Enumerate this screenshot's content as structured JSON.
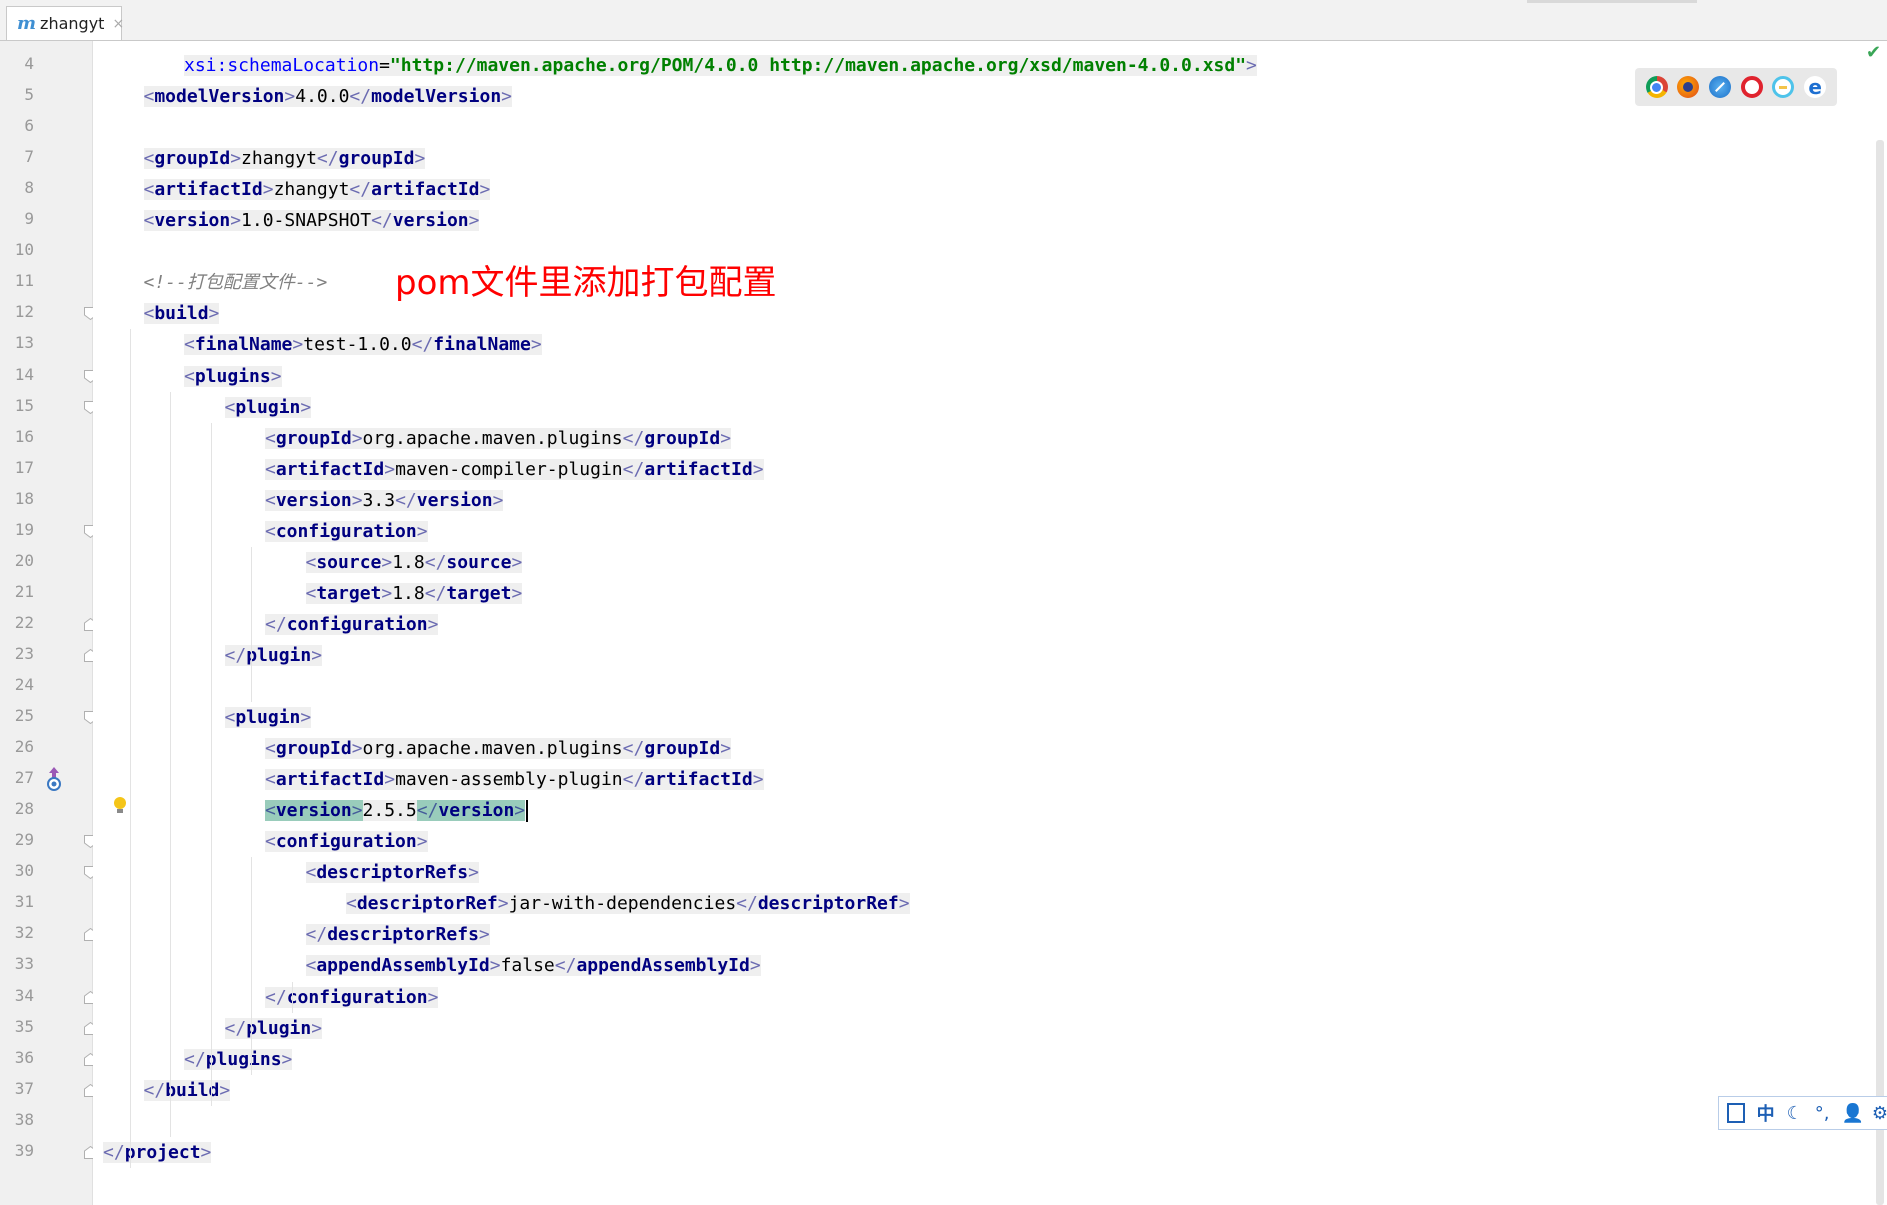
{
  "tab": {
    "icon": "m",
    "label": "zhangyt",
    "close": "×"
  },
  "annotation": "pom文件里添加打包配置",
  "lines": [
    {
      "num": "4",
      "indent": 2,
      "kind": "attr",
      "attr": "xsi:schemaLocation",
      "value": "\"http://maven.apache.org/POM/4.0.0 http://maven.apache.org/xsd/maven-4.0.0.xsd\""
    },
    {
      "num": "5",
      "indent": 1,
      "kind": "elem",
      "tag": "modelVersion",
      "text": "4.0.0"
    },
    {
      "num": "6",
      "indent": 0,
      "kind": "blank"
    },
    {
      "num": "7",
      "indent": 1,
      "kind": "elem",
      "tag": "groupId",
      "text": "zhangyt"
    },
    {
      "num": "8",
      "indent": 1,
      "kind": "elem",
      "tag": "artifactId",
      "text": "zhangyt"
    },
    {
      "num": "9",
      "indent": 1,
      "kind": "elem",
      "tag": "version",
      "text": "1.0-SNAPSHOT"
    },
    {
      "num": "10",
      "indent": 0,
      "kind": "blank"
    },
    {
      "num": "11",
      "indent": 1,
      "kind": "comment",
      "text": "<!--打包配置文件-->"
    },
    {
      "num": "12",
      "indent": 1,
      "kind": "open",
      "tag": "build"
    },
    {
      "num": "13",
      "indent": 2,
      "kind": "elem",
      "tag": "finalName",
      "text": "test-1.0.0"
    },
    {
      "num": "14",
      "indent": 2,
      "kind": "open",
      "tag": "plugins"
    },
    {
      "num": "15",
      "indent": 3,
      "kind": "open",
      "tag": "plugin"
    },
    {
      "num": "16",
      "indent": 4,
      "kind": "elem",
      "tag": "groupId",
      "text": "org.apache.maven.plugins"
    },
    {
      "num": "17",
      "indent": 4,
      "kind": "elem",
      "tag": "artifactId",
      "text": "maven-compiler-plugin"
    },
    {
      "num": "18",
      "indent": 4,
      "kind": "elem",
      "tag": "version",
      "text": "3.3"
    },
    {
      "num": "19",
      "indent": 4,
      "kind": "open",
      "tag": "configuration"
    },
    {
      "num": "20",
      "indent": 5,
      "kind": "elem",
      "tag": "source",
      "text": "1.8"
    },
    {
      "num": "21",
      "indent": 5,
      "kind": "elem",
      "tag": "target",
      "text": "1.8"
    },
    {
      "num": "22",
      "indent": 4,
      "kind": "close",
      "tag": "configuration"
    },
    {
      "num": "23",
      "indent": 3,
      "kind": "close",
      "tag": "plugin"
    },
    {
      "num": "24",
      "indent": 0,
      "kind": "blank"
    },
    {
      "num": "25",
      "indent": 3,
      "kind": "open",
      "tag": "plugin"
    },
    {
      "num": "26",
      "indent": 4,
      "kind": "elem",
      "tag": "groupId",
      "text": "org.apache.maven.plugins"
    },
    {
      "num": "27",
      "indent": 4,
      "kind": "elem",
      "tag": "artifactId",
      "text": "maven-assembly-plugin"
    },
    {
      "num": "28",
      "indent": 4,
      "kind": "elem",
      "tag": "version",
      "text": "2.5.5",
      "current": true
    },
    {
      "num": "29",
      "indent": 4,
      "kind": "open",
      "tag": "configuration"
    },
    {
      "num": "30",
      "indent": 5,
      "kind": "open",
      "tag": "descriptorRefs"
    },
    {
      "num": "31",
      "indent": 6,
      "kind": "elem",
      "tag": "descriptorRef",
      "text": "jar-with-dependencies"
    },
    {
      "num": "32",
      "indent": 5,
      "kind": "close",
      "tag": "descriptorRefs"
    },
    {
      "num": "33",
      "indent": 5,
      "kind": "elem",
      "tag": "appendAssemblyId",
      "text": "false"
    },
    {
      "num": "34",
      "indent": 4,
      "kind": "close",
      "tag": "configuration"
    },
    {
      "num": "35",
      "indent": 3,
      "kind": "close",
      "tag": "plugin"
    },
    {
      "num": "36",
      "indent": 2,
      "kind": "close",
      "tag": "plugins"
    },
    {
      "num": "37",
      "indent": 1,
      "kind": "close",
      "tag": "build"
    },
    {
      "num": "38",
      "indent": 0,
      "kind": "blank"
    },
    {
      "num": "39",
      "indent": 0,
      "kind": "close",
      "tag": "project"
    }
  ],
  "browser_icons": [
    "chrome-icon",
    "firefox-icon",
    "safari-icon",
    "opera-icon",
    "ie-icon",
    "edge-icon"
  ],
  "ime": {
    "mode": "中"
  },
  "colors": {
    "tag": "#000080",
    "attr": "#0000ff",
    "attrval": "#008000",
    "comment": "#808080",
    "annotation": "#ff0000",
    "current_line": "#fffae3"
  }
}
